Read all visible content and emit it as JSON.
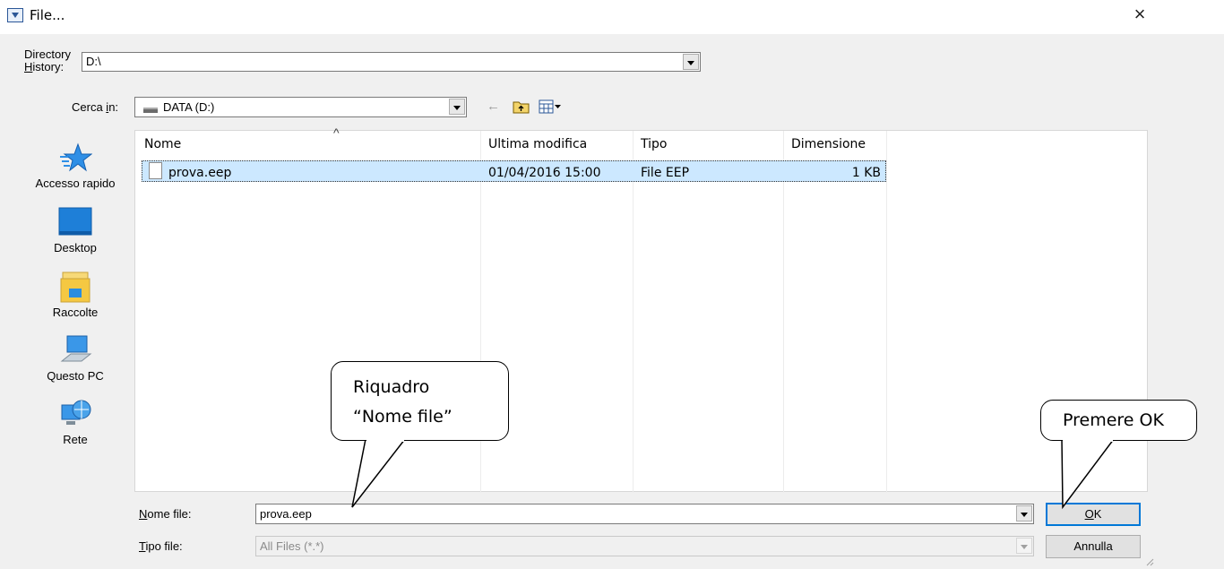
{
  "window": {
    "title": "File...",
    "close_glyph": "×"
  },
  "directory_history": {
    "label_line1": "Directory",
    "label_line2_accel": "H",
    "label_line2_rest": "istory:",
    "value": "D:\\"
  },
  "look_in": {
    "label_pre": "Cerca ",
    "label_accel": "i",
    "label_post": "n:",
    "value": "DATA (D:)",
    "drive_icon": "drive-icon"
  },
  "toolbar": {
    "back_icon": "back-arrow-icon",
    "up_folder_icon": "folder-up-icon",
    "view_menu_icon": "view-menu-icon"
  },
  "places": [
    {
      "label": "Accesso rapido",
      "icon": "star-icon"
    },
    {
      "label": "Desktop",
      "icon": "desktop-icon"
    },
    {
      "label": "Raccolte",
      "icon": "libraries-icon"
    },
    {
      "label": "Questo PC",
      "icon": "computer-icon"
    },
    {
      "label": "Rete",
      "icon": "network-icon"
    }
  ],
  "file_list": {
    "sort_indicator": "^",
    "columns": [
      "Nome",
      "Ultima modifica",
      "Tipo",
      "Dimensione"
    ],
    "rows": [
      {
        "name": "prova.eep",
        "modified": "01/04/2016 15:00",
        "type": "File EEP",
        "size": "1 KB",
        "icon": "file-icon",
        "selected": true
      }
    ]
  },
  "filename": {
    "label_accel": "N",
    "label_rest": "ome file:",
    "value": "prova.eep"
  },
  "filetype": {
    "label_accel": "T",
    "label_rest": "ipo file:",
    "value": "All Files (*.*)"
  },
  "buttons": {
    "ok_accel": "O",
    "ok_rest": "K",
    "cancel": "Annulla"
  },
  "callouts": {
    "filename_line1": "Riquadro",
    "filename_line2": "“Nome file”",
    "ok": "Premere OK"
  },
  "colors": {
    "selection": "#cce8ff",
    "dialog_bg": "#f0f0f0",
    "ok_border": "#0078d7"
  }
}
